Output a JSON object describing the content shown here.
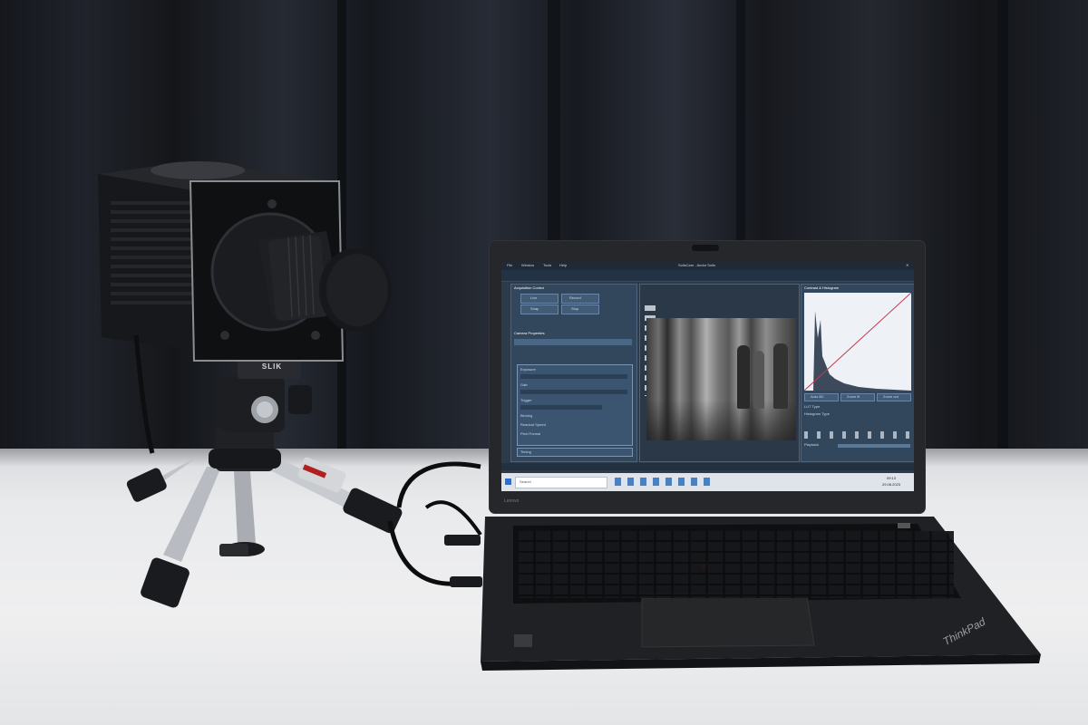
{
  "scene": {
    "camera": {
      "badge": "SLIK"
    },
    "laptop": {
      "brand_lid": "Lenovo",
      "brand_deck": "ThinkPad"
    },
    "screen": {
      "title_bar": "SolisCam - Andor Solis",
      "menu": [
        "File",
        "Window",
        "Tools",
        "Help"
      ],
      "left_panel": {
        "title": "Acquisition Control",
        "buttons": [
          "Live",
          "Record",
          "Snap",
          "Stop"
        ],
        "section": "Camera Properties",
        "fields": [
          "Exposure",
          "Gain",
          "Trigger",
          "Binning",
          "Readout Speed",
          "Pixel Format"
        ],
        "footer": "Timing"
      },
      "right_panel": {
        "title": "Contrast & Histogram",
        "buttons": [
          "Auto BC",
          "Zoom fit",
          "Zoom out"
        ],
        "rows": [
          "LUT Type",
          "Histogram Type",
          "Playback"
        ]
      },
      "taskbar": {
        "search": "Search",
        "time": "09:13",
        "date": "29.08.2023"
      }
    }
  }
}
